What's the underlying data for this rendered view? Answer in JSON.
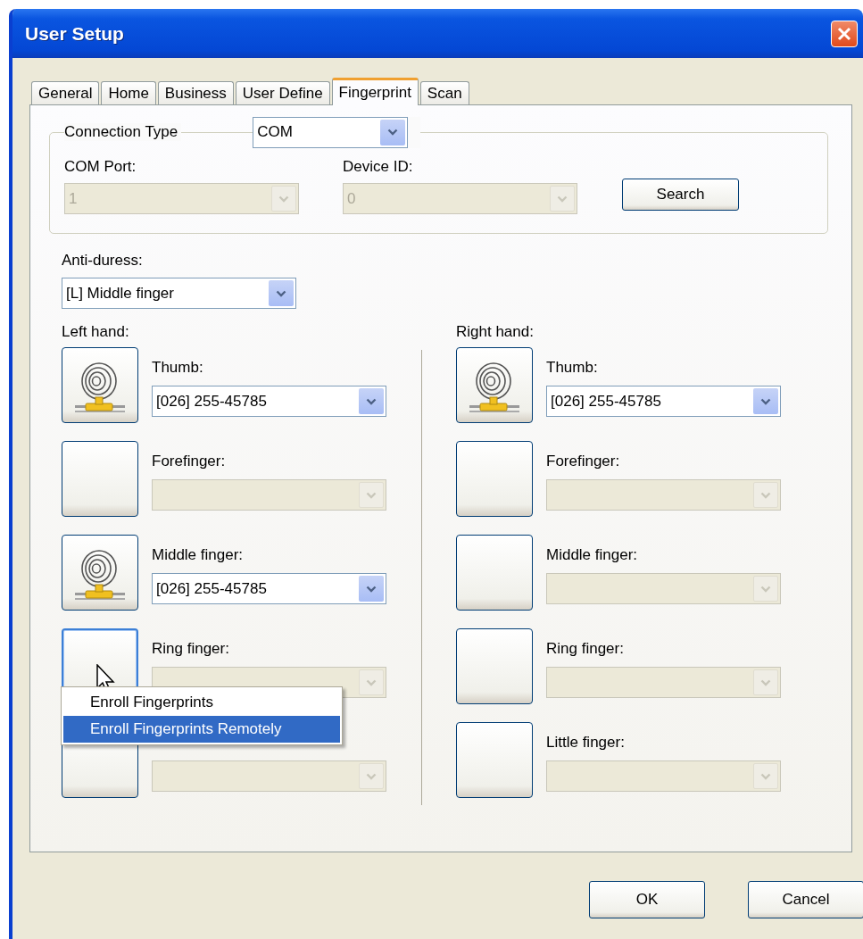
{
  "window": {
    "title": "User Setup"
  },
  "tabs": [
    {
      "label": "General",
      "selected": false
    },
    {
      "label": "Home",
      "selected": false
    },
    {
      "label": "Business",
      "selected": false
    },
    {
      "label": "User Define",
      "selected": false
    },
    {
      "label": "Fingerprint",
      "selected": true
    },
    {
      "label": "Scan",
      "selected": false
    }
  ],
  "connection": {
    "label": "Connection Type",
    "type": {
      "value": "COM",
      "disabled": false
    },
    "com_port": {
      "label": "COM Port:",
      "value": "1",
      "disabled": true
    },
    "device_id": {
      "label": "Device ID:",
      "value": "0",
      "disabled": true
    },
    "search_button": "Search"
  },
  "anti_duress": {
    "label": "Anti-duress:",
    "value": "[L] Middle finger",
    "disabled": false
  },
  "hands": [
    {
      "label": "Left hand:",
      "fingers": [
        {
          "label": "Thumb:",
          "enrolled": true,
          "hovered": false,
          "value": "[026] 255-45785",
          "disabled": false
        },
        {
          "label": "Forefinger:",
          "enrolled": false,
          "hovered": false,
          "disabled": true
        },
        {
          "label": "Middle finger:",
          "enrolled": true,
          "hovered": false,
          "value": "[026] 255-45785",
          "disabled": false
        },
        {
          "label": "Ring finger:",
          "enrolled": false,
          "hovered": true,
          "disabled": true
        },
        {
          "enrolled": false,
          "hovered": false,
          "disabled": true
        }
      ]
    },
    {
      "label": "Right hand:",
      "fingers": [
        {
          "label": "Thumb:",
          "enrolled": true,
          "hovered": false,
          "value": "[026] 255-45785",
          "disabled": false
        },
        {
          "label": "Forefinger:",
          "enrolled": false,
          "hovered": false,
          "disabled": true
        },
        {
          "label": "Middle finger:",
          "enrolled": false,
          "hovered": false,
          "disabled": true
        },
        {
          "label": "Ring finger:",
          "enrolled": false,
          "hovered": false,
          "disabled": true
        },
        {
          "label": "Little finger:",
          "enrolled": false,
          "hovered": false,
          "disabled": true
        }
      ]
    }
  ],
  "context_menu": {
    "items": [
      {
        "label": "Enroll Fingerprints",
        "selected": false
      },
      {
        "label": "Enroll Fingerprints Remotely",
        "selected": true
      }
    ]
  },
  "buttons": [
    "OK",
    "Cancel"
  ]
}
